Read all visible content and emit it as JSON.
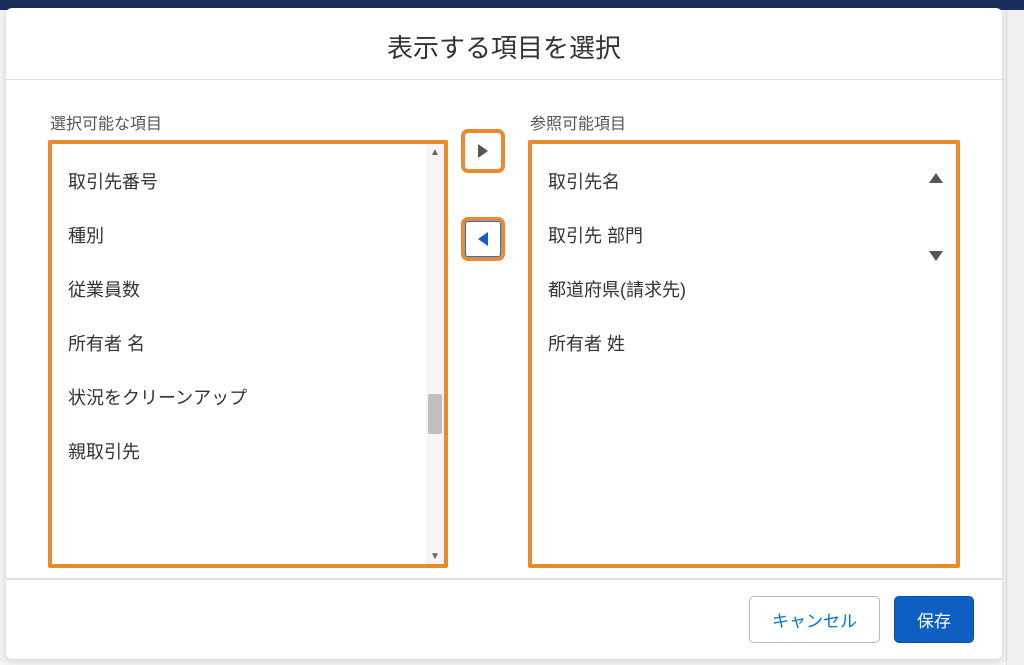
{
  "modal": {
    "title": "表示する項目を選択",
    "cancel_label": "キャンセル",
    "save_label": "保存"
  },
  "available": {
    "label": "選択可能な項目",
    "items": [
      "取引先番号",
      "種別",
      "従業員数",
      "所有者 名",
      "状況をクリーンアップ",
      "親取引先"
    ]
  },
  "selected": {
    "label": "参照可能項目",
    "items": [
      "取引先名",
      "取引先 部門",
      "都道府県(請求先)",
      "所有者 姓"
    ]
  }
}
